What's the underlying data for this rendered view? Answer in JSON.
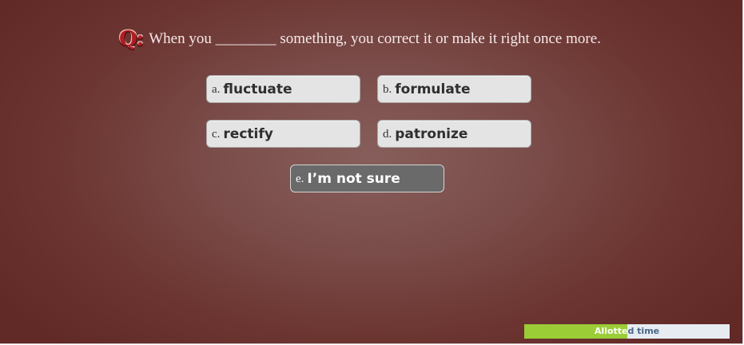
{
  "question": {
    "marker": "Q:",
    "text": "When you ________ something, you correct it or make it right once more."
  },
  "answers": [
    {
      "letter": "a.",
      "word": "fluctuate"
    },
    {
      "letter": "b.",
      "word": "formulate"
    },
    {
      "letter": "c.",
      "word": "rectify"
    },
    {
      "letter": "d.",
      "word": "patronize"
    },
    {
      "letter": "e.",
      "word": "I’m not sure"
    }
  ],
  "timer": {
    "label": "Allotted time",
    "progress_fraction": 0.5,
    "fill_color": "#9bcd37",
    "track_color": "#e7ecf3"
  },
  "colors": {
    "background": "#7b4d4a",
    "answer_bg": "#e4e4e4",
    "unsure_bg": "#6a6a6a",
    "marker": "#b31e22"
  }
}
